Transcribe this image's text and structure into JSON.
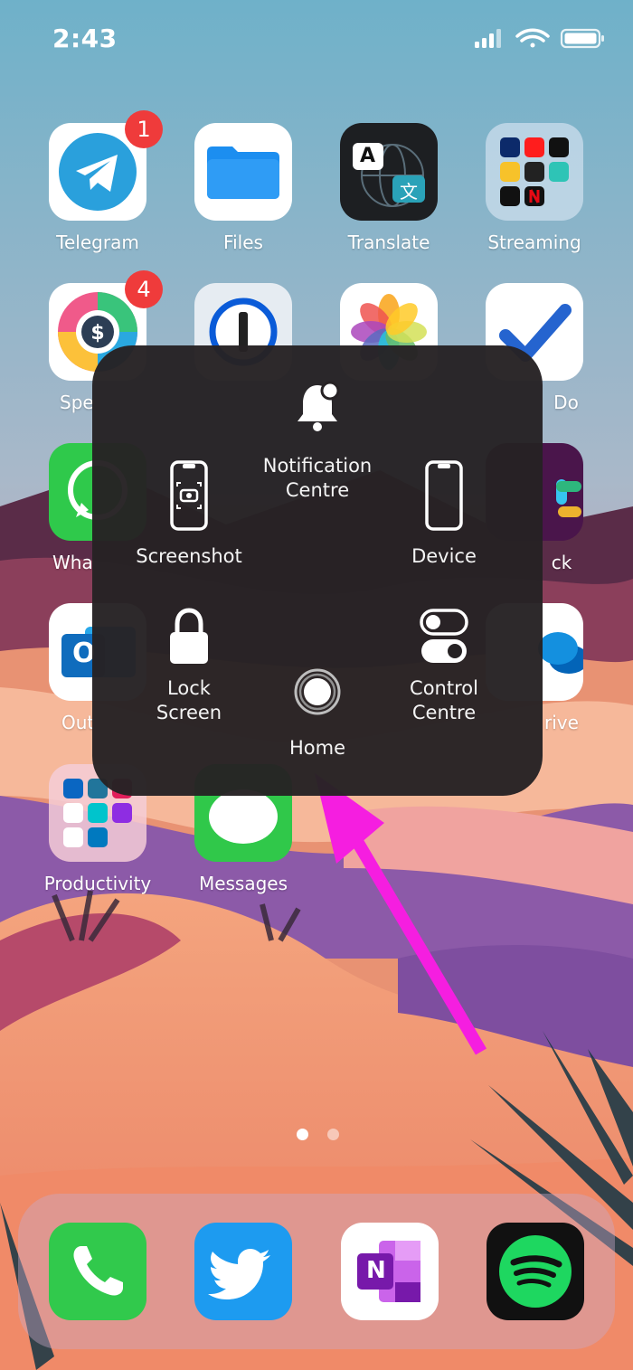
{
  "status_bar": {
    "time": "2:43"
  },
  "home_grid": {
    "row1": [
      {
        "label": "Telegram",
        "badge": "1",
        "icon": "telegram-icon"
      },
      {
        "label": "Files",
        "icon": "files-icon"
      },
      {
        "label": "Translate",
        "icon": "translate-icon",
        "glyph_a": "A",
        "glyph_b": "文"
      },
      {
        "label": "Streaming",
        "icon": "streaming-folder-icon"
      }
    ],
    "row2": [
      {
        "label": "Spe",
        "badge": "4",
        "icon": "spendee-icon"
      },
      {
        "label": "",
        "icon": "1password-icon"
      },
      {
        "label": "",
        "icon": "photos-icon"
      },
      {
        "label": "Do",
        "icon": "microsoft-todo-icon"
      }
    ],
    "row3": [
      {
        "label": "Wha",
        "icon": "whatsapp-icon"
      },
      {
        "label": "ck",
        "icon": "slack-icon"
      }
    ],
    "row4": [
      {
        "label": "Out",
        "icon": "outlook-icon",
        "glyph": "O"
      },
      {
        "label": "rive",
        "icon": "onedrive-icon"
      }
    ],
    "row5": [
      {
        "label": "Productivity",
        "icon": "productivity-folder-icon"
      },
      {
        "label": "Messages",
        "icon": "messages-icon"
      }
    ]
  },
  "assistive_menu": {
    "notification_centre": "Notification\nCentre",
    "screenshot": "Screenshot",
    "device": "Device",
    "lock_screen": "Lock\nScreen",
    "home": "Home",
    "control_centre": "Control\nCentre"
  },
  "dock": [
    {
      "icon": "phone-icon"
    },
    {
      "icon": "twitter-icon"
    },
    {
      "icon": "onenote-icon",
      "glyph": "N"
    },
    {
      "icon": "spotify-icon"
    }
  ],
  "page_indicator": {
    "pages": 2,
    "current": 1
  },
  "colors": {
    "menu_bg": "#262224",
    "arrow": "#f51ee0",
    "badge": "#ef3b3b"
  }
}
